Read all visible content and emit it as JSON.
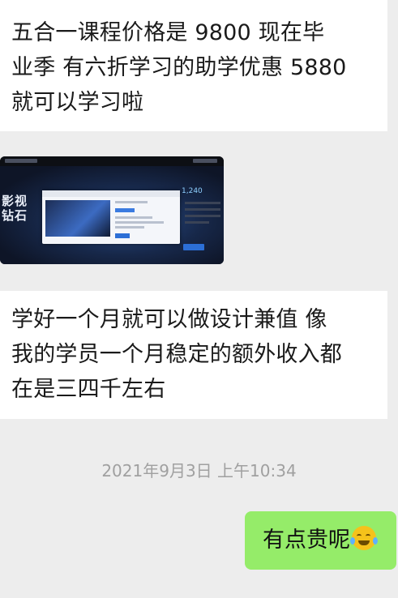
{
  "messages": [
    {
      "lines": [
        "五合一课程价格是 9800   现在毕",
        "业季 有六折学习的助学优惠 5880",
        "就可以学习啦"
      ]
    },
    {
      "image": {
        "hero_lines": [
          "影视",
          "钻石"
        ],
        "badge_number": "1,240"
      }
    },
    {
      "lines": [
        "学好一个月就可以做设计兼值  像",
        "我的学员一个月稳定的额外收入都",
        "在是三四千左右"
      ]
    }
  ],
  "timestamp": "2021年9月3日 上午10:34",
  "reply": {
    "text": "有点贵呢",
    "emoji": "laughing-crying-emoji"
  },
  "colors": {
    "background": "#ededed",
    "incoming_bubble": "#ffffff",
    "outgoing_bubble": "#95ec69",
    "timestamp": "#a0a0a0"
  }
}
